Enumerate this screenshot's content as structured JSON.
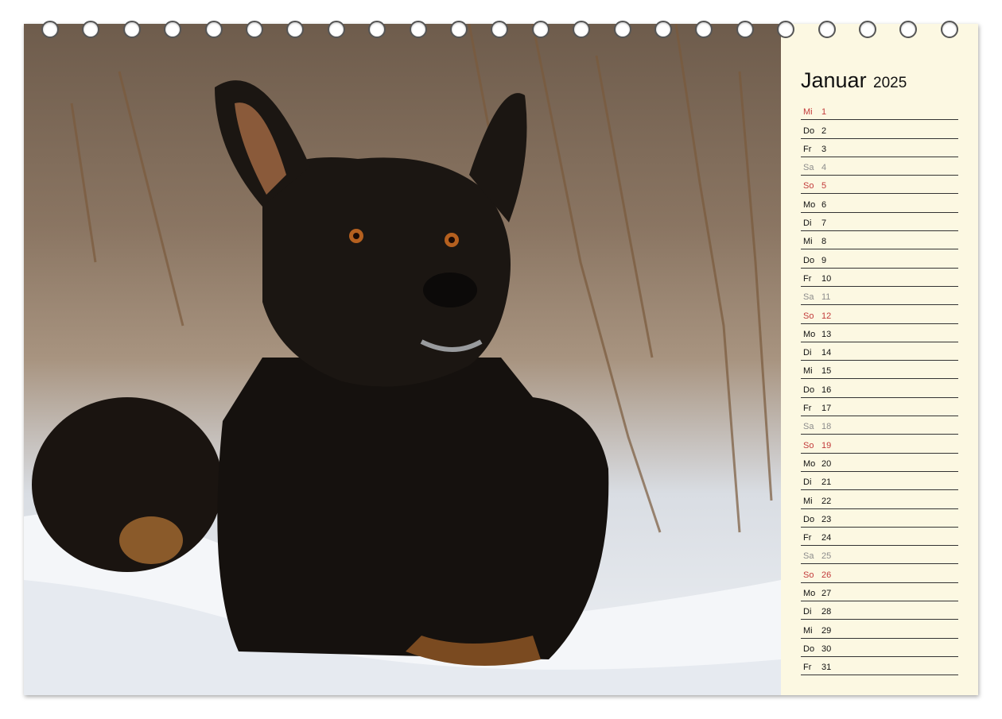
{
  "calendar": {
    "month": "Januar",
    "year": "2025",
    "days": [
      {
        "wd": "Mi",
        "d": "1",
        "type": "hol"
      },
      {
        "wd": "Do",
        "d": "2",
        "type": "work"
      },
      {
        "wd": "Fr",
        "d": "3",
        "type": "work"
      },
      {
        "wd": "Sa",
        "d": "4",
        "type": "sat"
      },
      {
        "wd": "So",
        "d": "5",
        "type": "sun"
      },
      {
        "wd": "Mo",
        "d": "6",
        "type": "work"
      },
      {
        "wd": "Di",
        "d": "7",
        "type": "work"
      },
      {
        "wd": "Mi",
        "d": "8",
        "type": "work"
      },
      {
        "wd": "Do",
        "d": "9",
        "type": "work"
      },
      {
        "wd": "Fr",
        "d": "10",
        "type": "work"
      },
      {
        "wd": "Sa",
        "d": "11",
        "type": "sat"
      },
      {
        "wd": "So",
        "d": "12",
        "type": "sun"
      },
      {
        "wd": "Mo",
        "d": "13",
        "type": "work"
      },
      {
        "wd": "Di",
        "d": "14",
        "type": "work"
      },
      {
        "wd": "Mi",
        "d": "15",
        "type": "work"
      },
      {
        "wd": "Do",
        "d": "16",
        "type": "work"
      },
      {
        "wd": "Fr",
        "d": "17",
        "type": "work"
      },
      {
        "wd": "Sa",
        "d": "18",
        "type": "sat"
      },
      {
        "wd": "So",
        "d": "19",
        "type": "sun"
      },
      {
        "wd": "Mo",
        "d": "20",
        "type": "work"
      },
      {
        "wd": "Di",
        "d": "21",
        "type": "work"
      },
      {
        "wd": "Mi",
        "d": "22",
        "type": "work"
      },
      {
        "wd": "Do",
        "d": "23",
        "type": "work"
      },
      {
        "wd": "Fr",
        "d": "24",
        "type": "work"
      },
      {
        "wd": "Sa",
        "d": "25",
        "type": "sat"
      },
      {
        "wd": "So",
        "d": "26",
        "type": "sun"
      },
      {
        "wd": "Mo",
        "d": "27",
        "type": "work"
      },
      {
        "wd": "Di",
        "d": "28",
        "type": "work"
      },
      {
        "wd": "Mi",
        "d": "29",
        "type": "work"
      },
      {
        "wd": "Do",
        "d": "30",
        "type": "work"
      },
      {
        "wd": "Fr",
        "d": "31",
        "type": "work"
      }
    ]
  },
  "binding": {
    "ring_count": 23
  },
  "photo": {
    "subject": "black-dog-in-snow-icon"
  },
  "colors": {
    "sunday": "#c23a3a",
    "saturday": "#8c8c8c",
    "panel": "#fcf8e2",
    "ink": "#111111"
  }
}
